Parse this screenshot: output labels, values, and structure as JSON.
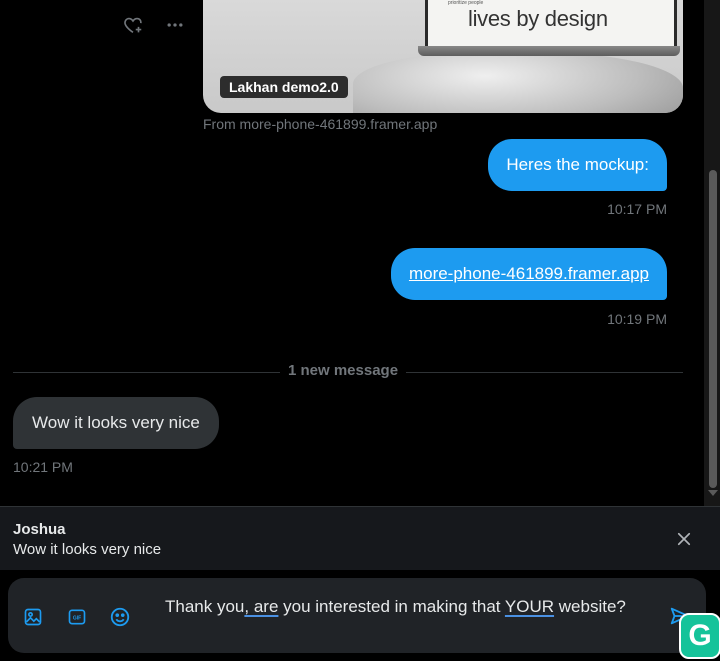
{
  "media": {
    "screen_title": "lives by design",
    "screen_tag": "prioritize people",
    "label": "Lakhan demo2.0",
    "source": "From more-phone-461899.framer.app"
  },
  "messages": [
    {
      "text": "Heres the mockup:",
      "time": "10:17 PM",
      "direction": "out"
    },
    {
      "text": "more-phone-461899.framer.app",
      "time": "10:19 PM",
      "direction": "out",
      "link": true
    },
    {
      "text": "Wow it looks very nice",
      "time": "10:21 PM",
      "direction": "in"
    }
  ],
  "divider_label": "1 new message",
  "reply": {
    "name": "Joshua",
    "text": "Wow it looks very nice"
  },
  "composer": {
    "part1": "Thank you",
    "part2": ", are",
    "part3": " you interested in making that ",
    "part4": "YOUR",
    "part5": " website?"
  },
  "icons": {
    "react": "heart-plus-icon",
    "more": "more-icon",
    "close": "close-icon",
    "media": "image-icon",
    "gif": "gif-icon",
    "emoji": "emoji-icon",
    "send": "send-icon",
    "grammarly": "grammarly-icon"
  },
  "colors": {
    "accent": "#1d9bf0",
    "incoming_bubble": "#2f3336",
    "muted": "#71767b",
    "grammarly": "#15c39a"
  },
  "grammarly_letter": "G"
}
